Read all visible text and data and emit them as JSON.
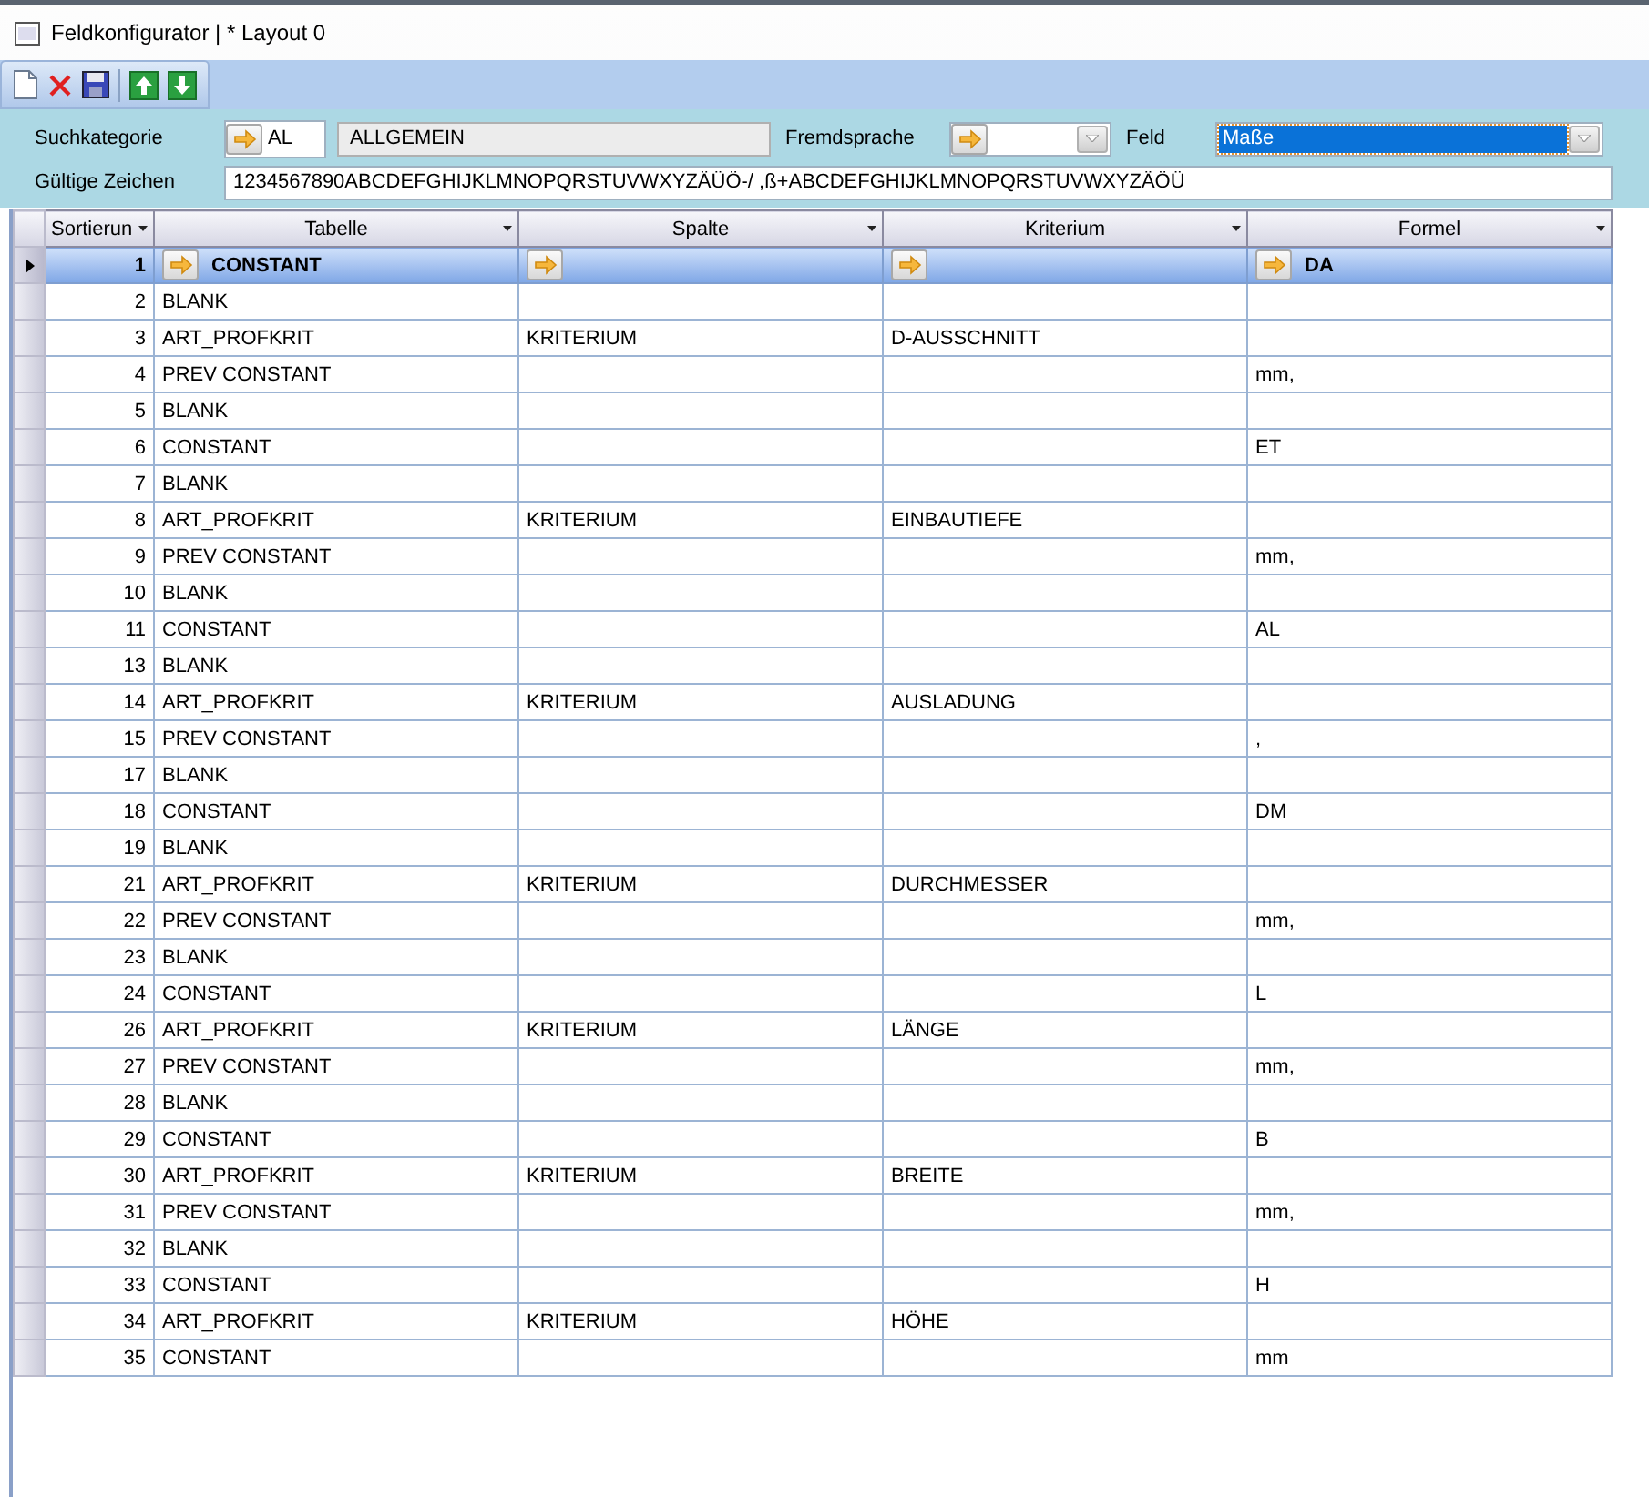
{
  "window": {
    "title": "Feldkonfigurator | * Layout 0"
  },
  "filters": {
    "suchkategorie": {
      "label": "Suchkategorie",
      "code": "AL",
      "name": "ALLGEMEIN"
    },
    "fremdsprache": {
      "label": "Fremdsprache"
    },
    "feld": {
      "label": "Feld",
      "value": "Maße",
      "selected": true
    },
    "gueltige_zeichen": {
      "label": "Gültige Zeichen",
      "value": "1234567890ABCDEFGHIJKLMNOPQRSTUVWXYZÄÜÖ-/ ,ß+ABCDEFGHIJKLMNOPQRSTUVWXYZÄÖÜ"
    }
  },
  "table": {
    "columns": [
      {
        "label": "Sortierun"
      },
      {
        "label": "Tabelle"
      },
      {
        "label": "Spalte"
      },
      {
        "label": "Kriterium"
      },
      {
        "label": "Formel"
      }
    ],
    "rows": [
      {
        "selected": true,
        "sortierung": "1",
        "tabelle": "CONSTANT",
        "formel": "DA"
      },
      {
        "selected": false,
        "sortierung": "2",
        "tabelle": "BLANK"
      },
      {
        "selected": false,
        "sortierung": "3",
        "tabelle": "ART_PROFKRIT",
        "spalte": "KRITERIUM",
        "kriterium": "D-AUSSCHNITT"
      },
      {
        "selected": false,
        "sortierung": "4",
        "tabelle": "PREV CONSTANT",
        "formel": "mm,"
      },
      {
        "selected": false,
        "sortierung": "5",
        "tabelle": "BLANK"
      },
      {
        "selected": false,
        "sortierung": "6",
        "tabelle": "CONSTANT",
        "formel": "ET"
      },
      {
        "selected": false,
        "sortierung": "7",
        "tabelle": "BLANK"
      },
      {
        "selected": false,
        "sortierung": "8",
        "tabelle": "ART_PROFKRIT",
        "spalte": "KRITERIUM",
        "kriterium": "EINBAUTIEFE"
      },
      {
        "selected": false,
        "sortierung": "9",
        "tabelle": "PREV CONSTANT",
        "formel": "mm,"
      },
      {
        "selected": false,
        "sortierung": "10",
        "tabelle": "BLANK"
      },
      {
        "selected": false,
        "sortierung": "11",
        "tabelle": "CONSTANT",
        "formel": "AL"
      },
      {
        "selected": false,
        "sortierung": "13",
        "tabelle": "BLANK"
      },
      {
        "selected": false,
        "sortierung": "14",
        "tabelle": "ART_PROFKRIT",
        "spalte": "KRITERIUM",
        "kriterium": "AUSLADUNG"
      },
      {
        "selected": false,
        "sortierung": "15",
        "tabelle": "PREV CONSTANT",
        "formel": ","
      },
      {
        "selected": false,
        "sortierung": "17",
        "tabelle": "BLANK"
      },
      {
        "selected": false,
        "sortierung": "18",
        "tabelle": "CONSTANT",
        "formel": "DM"
      },
      {
        "selected": false,
        "sortierung": "19",
        "tabelle": "BLANK"
      },
      {
        "selected": false,
        "sortierung": "21",
        "tabelle": "ART_PROFKRIT",
        "spalte": "KRITERIUM",
        "kriterium": "DURCHMESSER"
      },
      {
        "selected": false,
        "sortierung": "22",
        "tabelle": "PREV CONSTANT",
        "formel": "mm,"
      },
      {
        "selected": false,
        "sortierung": "23",
        "tabelle": "BLANK"
      },
      {
        "selected": false,
        "sortierung": "24",
        "tabelle": "CONSTANT",
        "formel": "L"
      },
      {
        "selected": false,
        "sortierung": "26",
        "tabelle": "ART_PROFKRIT",
        "spalte": "KRITERIUM",
        "kriterium": "LÄNGE"
      },
      {
        "selected": false,
        "sortierung": "27",
        "tabelle": "PREV CONSTANT",
        "formel": "mm,"
      },
      {
        "selected": false,
        "sortierung": "28",
        "tabelle": "BLANK"
      },
      {
        "selected": false,
        "sortierung": "29",
        "tabelle": "CONSTANT",
        "formel": "B"
      },
      {
        "selected": false,
        "sortierung": "30",
        "tabelle": "ART_PROFKRIT",
        "spalte": "KRITERIUM",
        "kriterium": "BREITE"
      },
      {
        "selected": false,
        "sortierung": "31",
        "tabelle": "PREV CONSTANT",
        "formel": "mm,"
      },
      {
        "selected": false,
        "sortierung": "32",
        "tabelle": "BLANK"
      },
      {
        "selected": false,
        "sortierung": "33",
        "tabelle": "CONSTANT",
        "formel": "H"
      },
      {
        "selected": false,
        "sortierung": "34",
        "tabelle": "ART_PROFKRIT",
        "spalte": "KRITERIUM",
        "kriterium": "HÖHE"
      },
      {
        "selected": false,
        "sortierung": "35",
        "tabelle": "CONSTANT",
        "formel": "mm"
      }
    ]
  }
}
